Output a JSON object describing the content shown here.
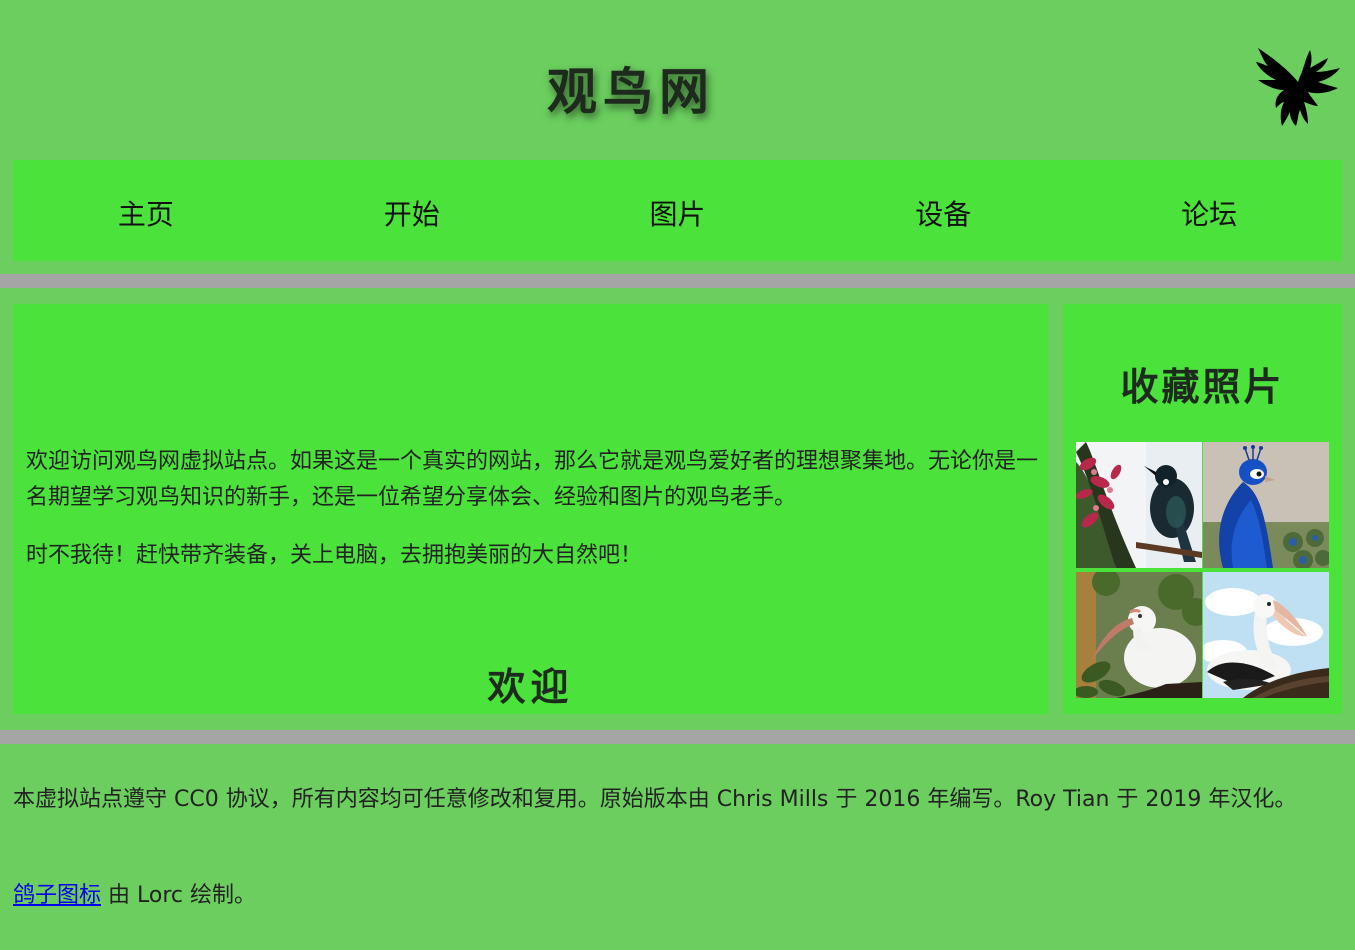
{
  "header": {
    "site_title": "观鸟网",
    "logo_icon": "bird-silhouette-icon"
  },
  "nav": {
    "items": [
      {
        "label": "主页"
      },
      {
        "label": "开始"
      },
      {
        "label": "图片"
      },
      {
        "label": "设备"
      },
      {
        "label": "论坛"
      }
    ]
  },
  "main": {
    "heading": "欢迎",
    "paragraph_1": "欢迎访问观鸟网虚拟站点。如果这是一个真实的网站，那么它就是观鸟爱好者的理想聚集地。无论你是一名期望学习观鸟知识的新手，还是一位希望分享体会、经验和图片的观鸟老手。",
    "paragraph_2": "时不我待！赶快带齐装备，关上电脑，去拥抱美丽的大自然吧！"
  },
  "sidebar": {
    "heading": "收藏照片",
    "photos": [
      {
        "subject": "tui-bird-photo"
      },
      {
        "subject": "peacock-photo"
      },
      {
        "subject": "ibis-photo"
      },
      {
        "subject": "pelican-photo"
      }
    ]
  },
  "footer": {
    "license_text": "本虚拟站点遵守 CC0 协议，所有内容均可任意修改和复用。原始版本由 Chris Mills 于 2016 年编写。Roy Tian 于 2019 年汉化。",
    "credit_link": "鸽子图标",
    "credit_suffix": " 由 Lorc 绘制。"
  },
  "colors": {
    "page_background": "#6bce5e",
    "panel_background": "#4ae23b",
    "divider": "#a5a5a5",
    "link": "#0000ee"
  }
}
